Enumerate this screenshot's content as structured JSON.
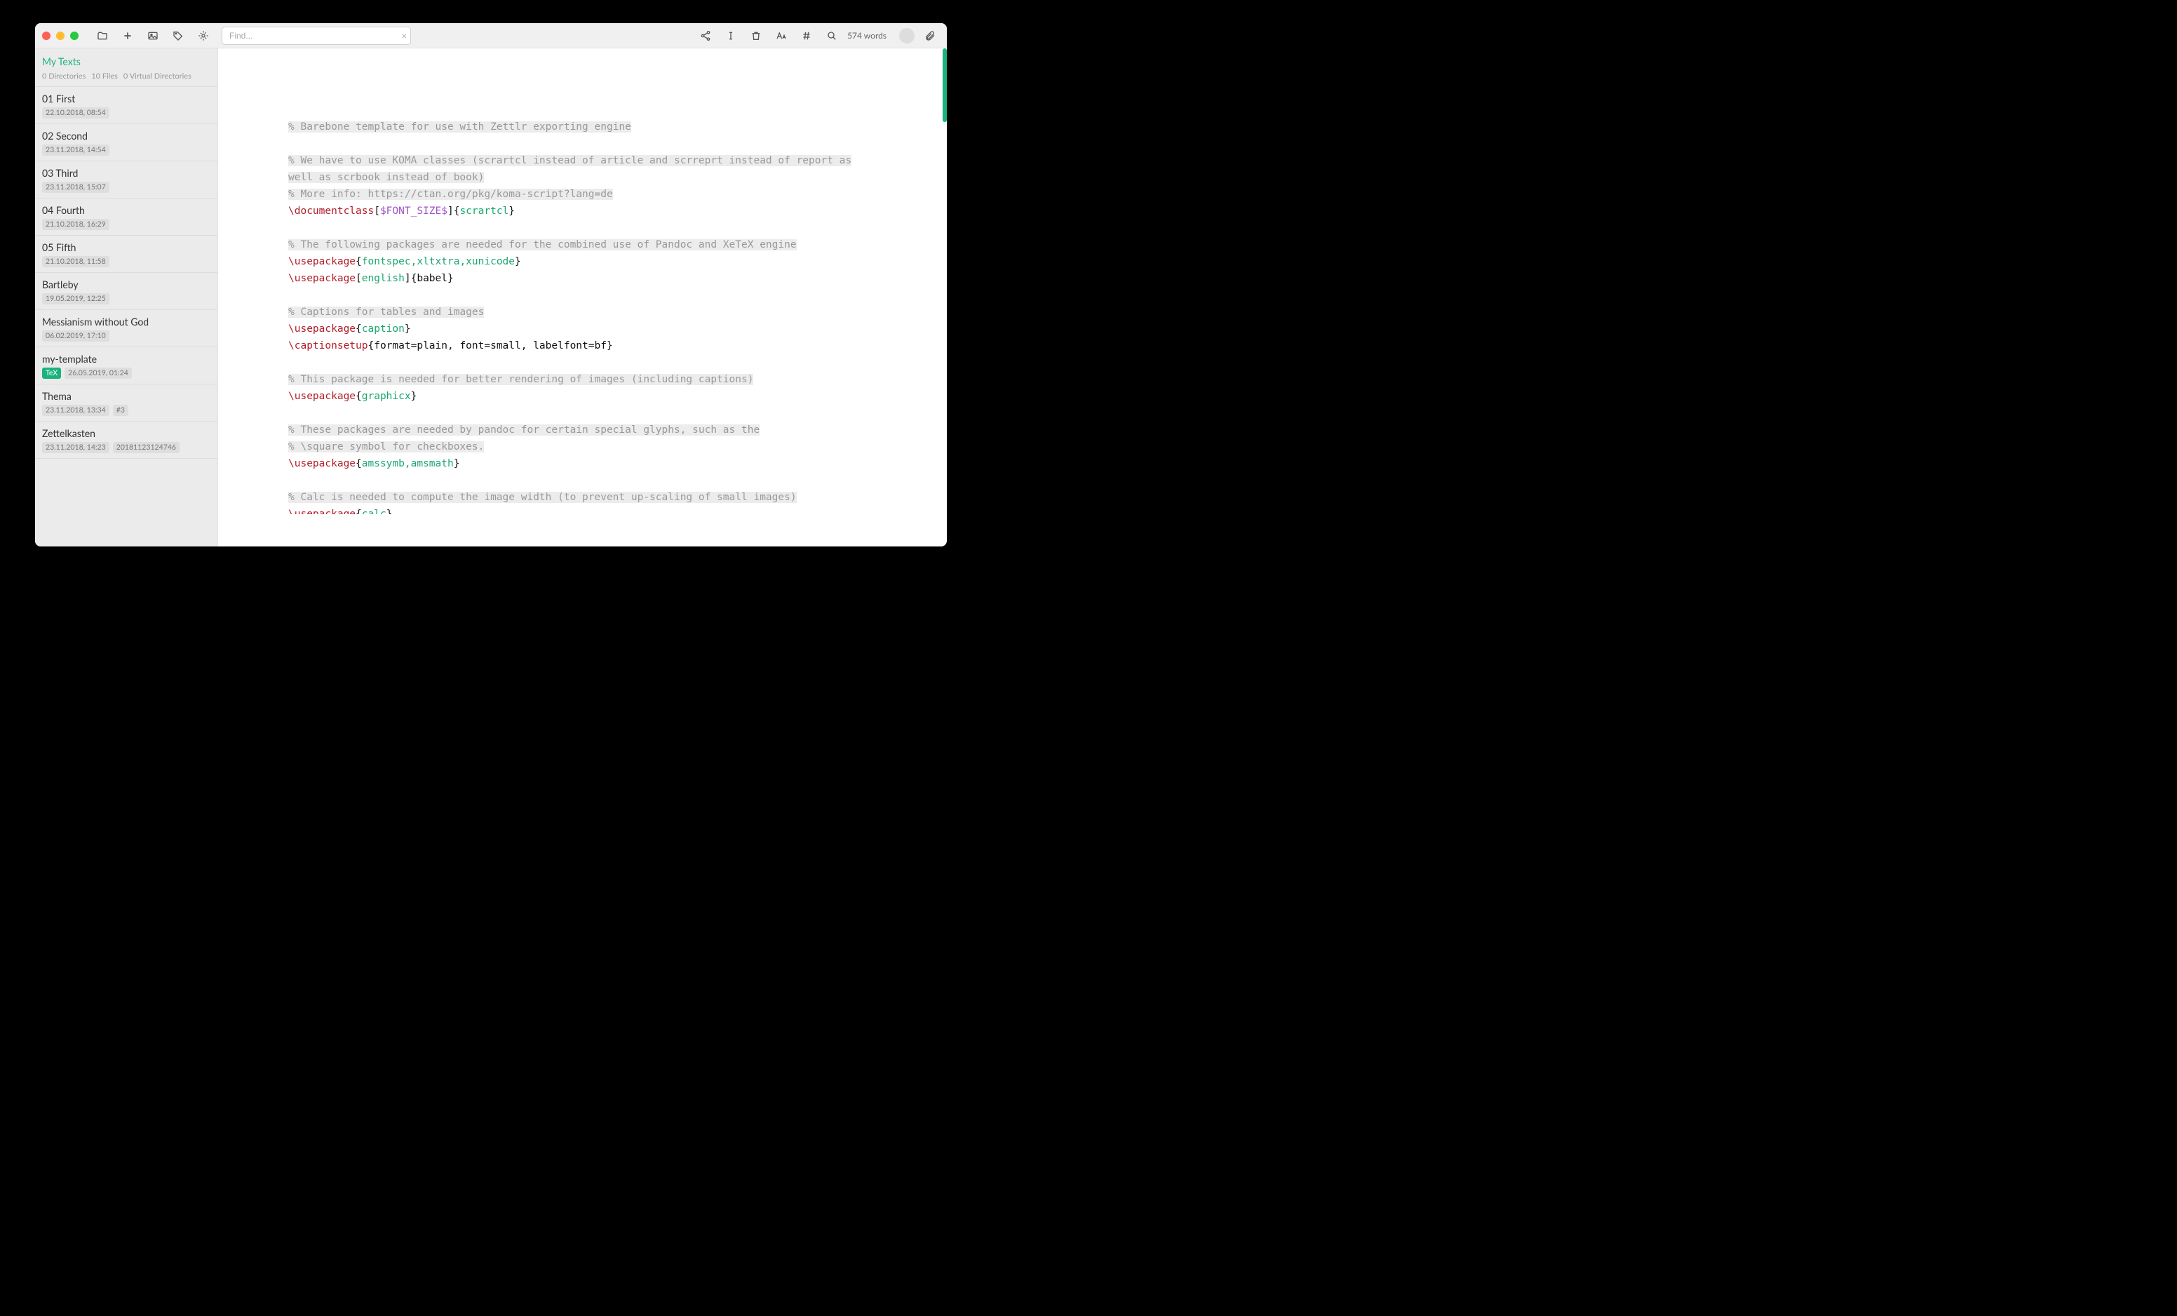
{
  "toolbar": {
    "search_placeholder": "Find...",
    "wordcount": "574 words"
  },
  "sidebar": {
    "title": "My Texts",
    "stats": {
      "directories": "0 Directories",
      "files": "10 Files",
      "virtual": "0 Virtual Directories"
    },
    "items": [
      {
        "title": "01 First",
        "date": "22.10.2018, 08:54"
      },
      {
        "title": "02 Second",
        "date": "23.11.2018, 14:54"
      },
      {
        "title": "03 Third",
        "date": "23.11.2018, 15:07"
      },
      {
        "title": "04 Fourth",
        "date": "21.10.2018, 16:29"
      },
      {
        "title": "05 Fifth",
        "date": "21.10.2018, 11:58"
      },
      {
        "title": "Bartleby",
        "date": "19.05.2019, 12:25"
      },
      {
        "title": "Messianism without God",
        "date": "06.02.2019, 17:10"
      },
      {
        "title": "my-template",
        "date": "26.05.2019, 01:24",
        "tag": "TeX"
      },
      {
        "title": "Thema",
        "date": "23.11.2018, 13:34",
        "id": "#3"
      },
      {
        "title": "Zettelkasten",
        "date": "23.11.2018, 14:23",
        "id": "20181123124746"
      }
    ]
  },
  "editor": {
    "lines": [
      {
        "t": "comment",
        "text": "% Barebone template for use with Zettlr exporting engine"
      },
      {
        "t": "blank"
      },
      {
        "t": "comment",
        "text": "% We have to use KOMA classes (scrartcl instead of article and scrreprt instead of report as well as scrbook instead of book)"
      },
      {
        "t": "comment",
        "text": "% More info: https://ctan.org/pkg/koma-script?lang=de"
      },
      {
        "t": "tex",
        "cmd": "\\documentclass",
        "opt": "$FONT_SIZE$",
        "arg": "scrartcl"
      },
      {
        "t": "blank"
      },
      {
        "t": "comment",
        "text": "% The following packages are needed for the combined use of Pandoc and XeTeX engine"
      },
      {
        "t": "tex",
        "cmd": "\\usepackage",
        "arg": "fontspec,xltxtra,xunicode"
      },
      {
        "t": "tex",
        "cmd": "\\usepackage",
        "opt": "english",
        "optcolor": "arg",
        "arg_plain": "babel"
      },
      {
        "t": "blank"
      },
      {
        "t": "comment",
        "text": "% Captions for tables and images"
      },
      {
        "t": "tex",
        "cmd": "\\usepackage",
        "arg": "caption"
      },
      {
        "t": "tex",
        "cmd": "\\captionsetup",
        "arg_plain": "format=plain, font=small, labelfont=bf"
      },
      {
        "t": "blank"
      },
      {
        "t": "comment",
        "text": "% This package is needed for better rendering of images (including captions)"
      },
      {
        "t": "tex",
        "cmd": "\\usepackage",
        "arg": "graphicx"
      },
      {
        "t": "blank"
      },
      {
        "t": "comment",
        "text": "% These packages are needed by pandoc for certain special glyphs, such as the"
      },
      {
        "t": "comment",
        "text": "% \\square symbol for checkboxes."
      },
      {
        "t": "tex",
        "cmd": "\\usepackage",
        "arg": "amssymb,amsmath"
      },
      {
        "t": "blank"
      },
      {
        "t": "comment",
        "text": "% Calc is needed to compute the image width (to prevent up-scaling of small images)"
      },
      {
        "t": "tex",
        "cmd": "\\usepackage",
        "arg": "calc",
        "clip": true
      }
    ]
  }
}
